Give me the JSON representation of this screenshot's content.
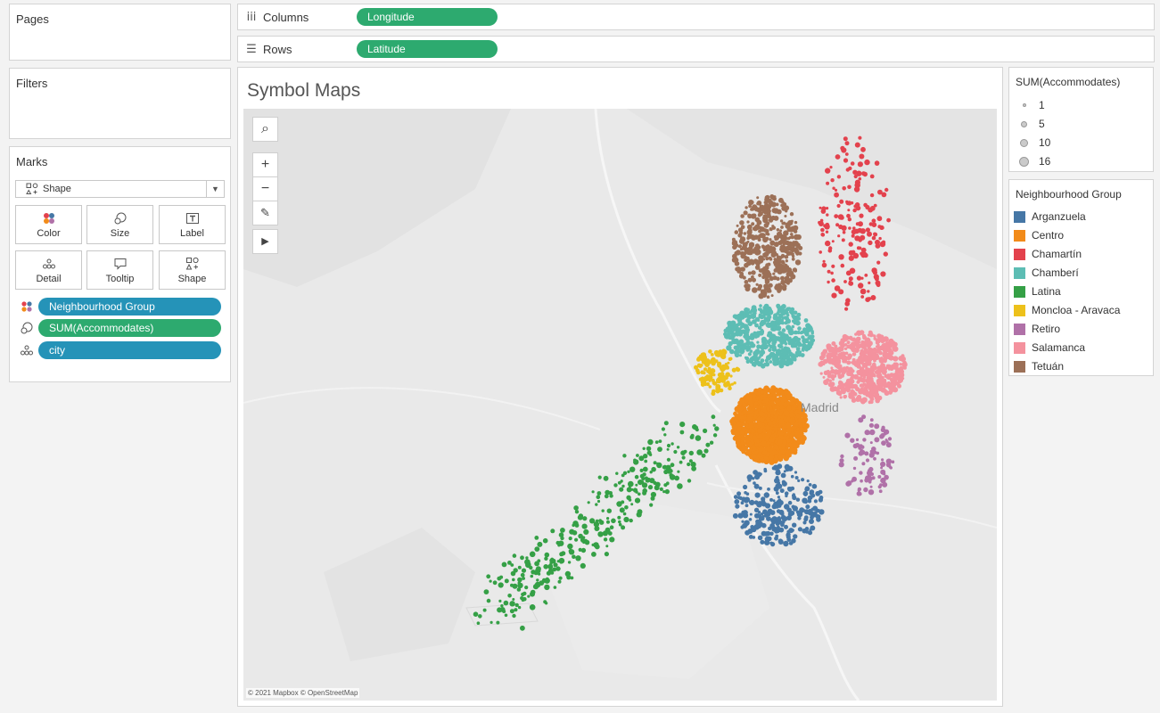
{
  "left": {
    "pages_title": "Pages",
    "filters_title": "Filters",
    "marks_title": "Marks",
    "mark_type": "Shape",
    "mark_buttons": [
      {
        "label": "Color",
        "icon": "color-dots-icon"
      },
      {
        "label": "Size",
        "icon": "size-icon"
      },
      {
        "label": "Label",
        "icon": "label-icon"
      },
      {
        "label": "Detail",
        "icon": "detail-icon"
      },
      {
        "label": "Tooltip",
        "icon": "tooltip-icon"
      },
      {
        "label": "Shape",
        "icon": "shape-icon"
      }
    ],
    "mark_fields": [
      {
        "label": "Neighbourhood Group",
        "icon": "color-dots-icon",
        "color": "#2593b8"
      },
      {
        "label": "SUM(Accommodates)",
        "icon": "size-icon",
        "color": "#2daa6f"
      },
      {
        "label": "city",
        "icon": "detail-icon",
        "color": "#2593b8"
      }
    ]
  },
  "shelves": {
    "columns_label": "Columns",
    "columns_pill": "Longitude",
    "rows_label": "Rows",
    "rows_pill": "Latitude"
  },
  "view": {
    "title": "Symbol Maps",
    "city_label": "Madrid",
    "attribution": "© 2021 Mapbox © OpenStreetMap",
    "tools": [
      "search-icon",
      "zoom-in-icon",
      "zoom-out-icon",
      "pin-icon",
      "play-icon"
    ]
  },
  "size_legend": {
    "title": "SUM(Accommodates)",
    "items": [
      "1",
      "5",
      "10",
      "16"
    ]
  },
  "color_legend": {
    "title": "Neighbourhood Group",
    "items": [
      {
        "label": "Arganzuela",
        "color": "#4677a6"
      },
      {
        "label": "Centro",
        "color": "#f28b1a"
      },
      {
        "label": "Chamartín",
        "color": "#e3424d"
      },
      {
        "label": "Chamberí",
        "color": "#5dbdb4"
      },
      {
        "label": "Latina",
        "color": "#35a046"
      },
      {
        "label": "Moncloa - Aravaca",
        "color": "#edc11b"
      },
      {
        "label": "Retiro",
        "color": "#b071a8"
      },
      {
        "label": "Salamanca",
        "color": "#f4929e"
      },
      {
        "label": "Tetuán",
        "color": "#9c7057"
      }
    ]
  }
}
